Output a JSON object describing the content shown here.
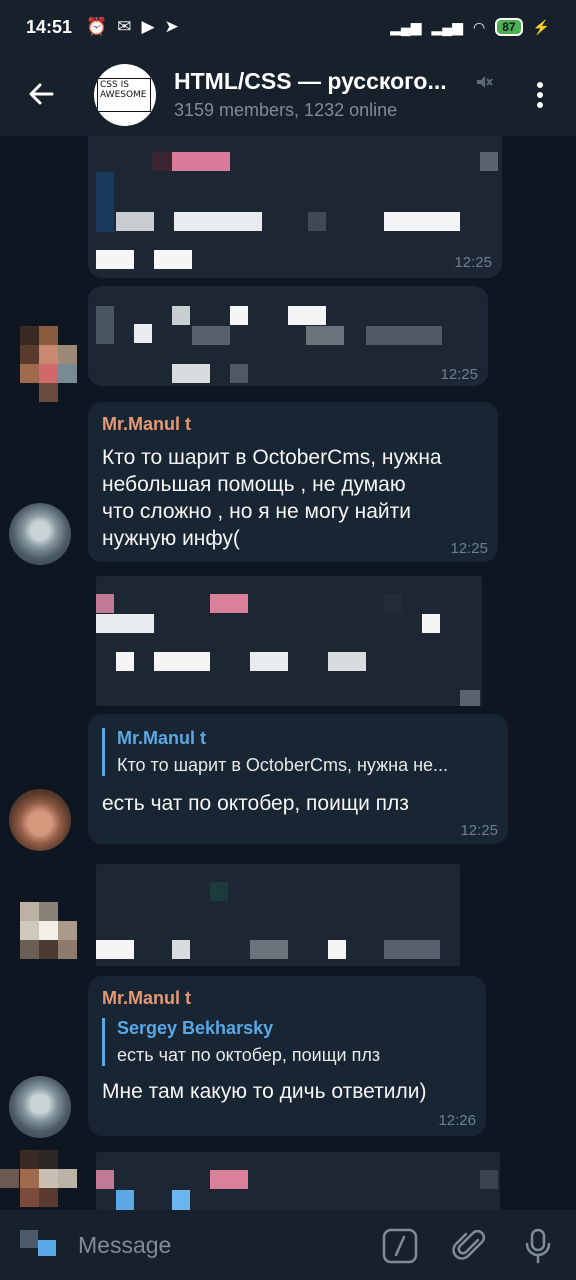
{
  "status": {
    "time": "14:51",
    "battery": "87"
  },
  "chat": {
    "title": "HTML/CSS — русского...",
    "subtitle": "3159 members, 1232 online",
    "avatar_text": "CSS IS AWESOME"
  },
  "messages": [
    {
      "time": "12:25"
    },
    {
      "time": "12:25"
    },
    {
      "sender": "Mr.Manul t",
      "lines": [
        "Кто то шарит в OctoberCms, нужна",
        "небольшая помощь , не думаю",
        "что сложно , но я не могу найти",
        "нужную инфу("
      ],
      "time": "12:25"
    },
    {
      "reply_name": "Mr.Manul t",
      "reply_text": "Кто то шарит в OctoberCms, нужна не...",
      "text": "есть чат по октобер, поищи плз",
      "time": "12:25"
    },
    {
      "sender": "Mr.Manul t",
      "reply_name": "Sergey Bekharsky",
      "reply_text": "есть чат по октобер, поищи плз",
      "text": "Мне там какую то дичь ответили)",
      "time": "12:26"
    }
  ],
  "input": {
    "placeholder": "Message"
  },
  "colors": {
    "background": "#0e1621",
    "bubble": "#182533",
    "sender": "#e69875",
    "reply_accent": "#5aa8e6",
    "battery": "#4caf50"
  }
}
